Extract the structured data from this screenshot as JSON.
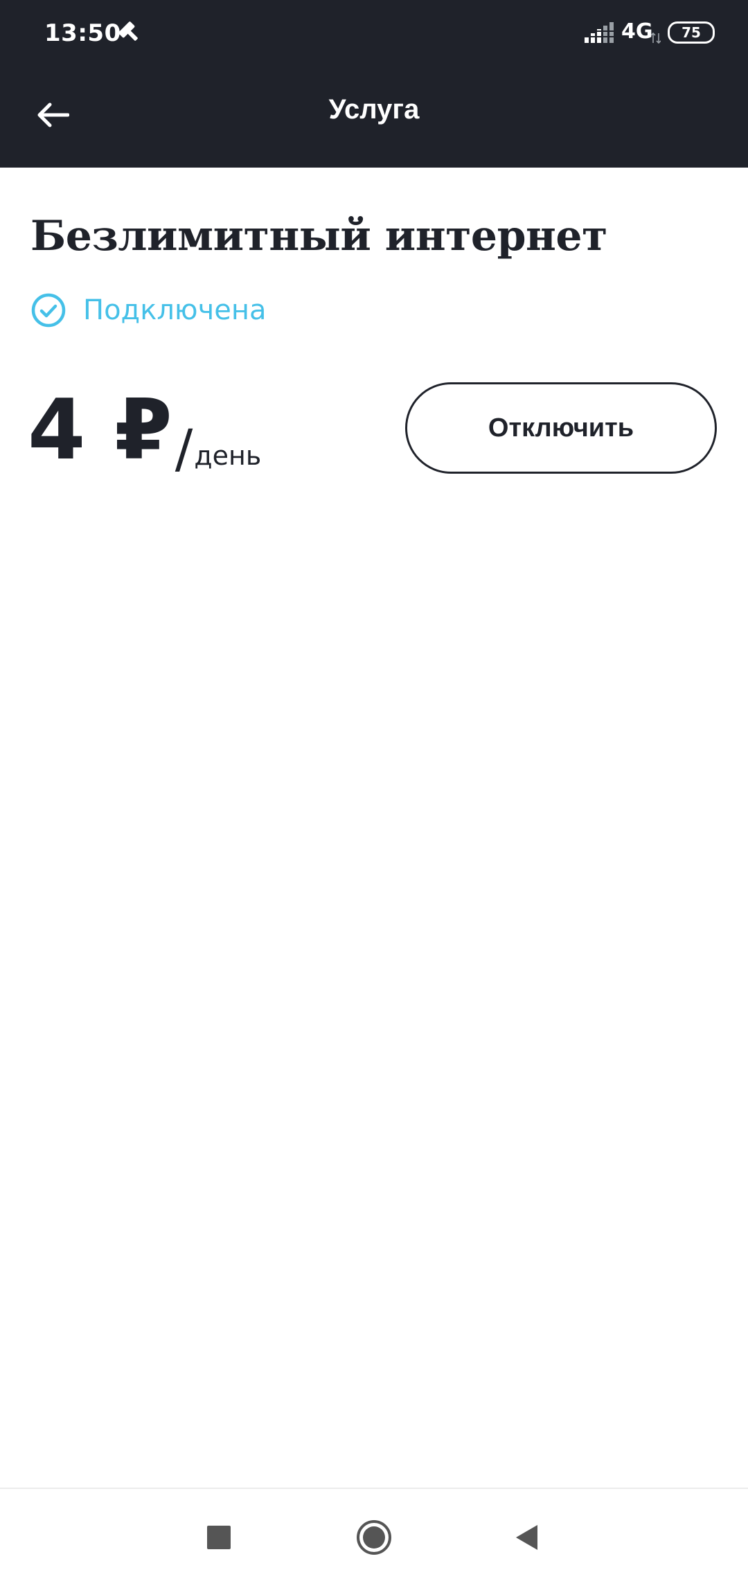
{
  "status_bar": {
    "time": "13:50",
    "network": "4G",
    "battery_level": "75",
    "icons": [
      "hammer-icon",
      "signal-icon",
      "data-arrows-icon",
      "battery-icon"
    ]
  },
  "toolbar": {
    "title": "Услуга",
    "back_icon": "arrow-left-icon"
  },
  "service": {
    "title": "Безлимитный интернет",
    "status": "Подключена",
    "status_icon": "check-circle-icon",
    "price_value": "4 ₽",
    "price_slash": "/",
    "price_period": "день",
    "disconnect_label": "Отключить"
  },
  "nav_bar": {
    "icons": [
      "recents-square-icon",
      "home-circle-icon",
      "back-triangle-icon"
    ]
  },
  "colors": {
    "header_bg": "#1f222a",
    "accent": "#45c0e8",
    "text_dark": "#1f222a",
    "background": "#ffffff"
  }
}
